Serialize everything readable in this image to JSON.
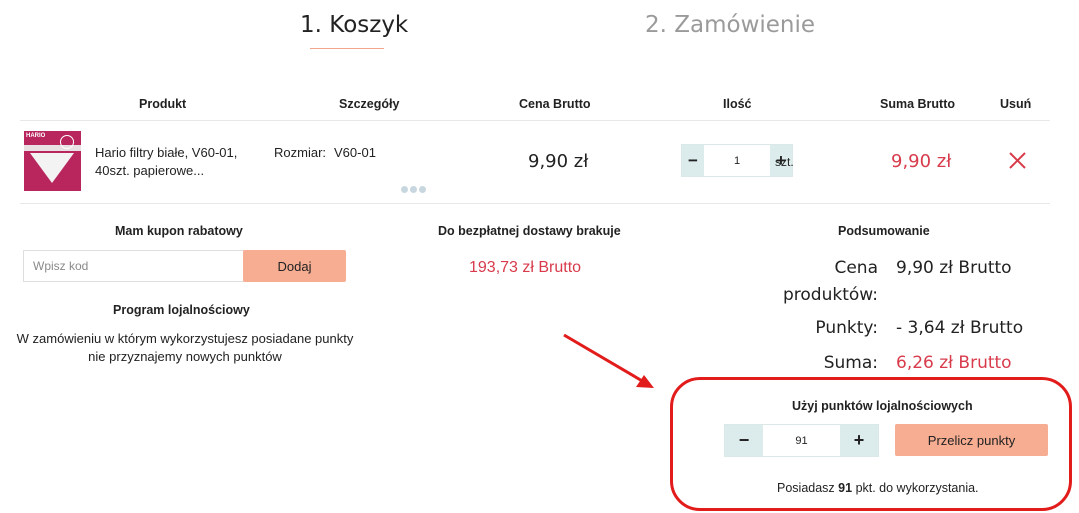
{
  "steps": [
    {
      "label": "1. Koszyk"
    },
    {
      "label": "2. Zamówienie"
    }
  ],
  "table": {
    "headers": [
      "Produkt",
      "Szczegóły",
      "Cena Brutto",
      "Ilość",
      "Suma Brutto",
      "Usuń"
    ],
    "row": {
      "product_name": "Hario filtry białe, V60-01, 40szt. papierowe...",
      "thumbnail_brand": "HARIO",
      "detail_label": "Rozmiar:",
      "detail_value": "V60-01",
      "price": "9,90 zł",
      "quantity": "1",
      "quantity_unit": "szt.",
      "total": "9,90 zł",
      "minus": "−",
      "plus": "+"
    }
  },
  "coupon": {
    "title": "Mam kupon rabatowy",
    "placeholder": "Wpisz kod",
    "button": "Dodaj"
  },
  "loyalty_program": {
    "title": "Program lojalnościowy",
    "text": "W zamówieniu w którym wykorzystujesz posiadane punkty nie przyznajemy nowych punktów"
  },
  "shipping": {
    "title": "Do bezpłatnej dostawy brakuje",
    "amount": "193,73 zł Brutto"
  },
  "summary": {
    "title": "Podsumowanie",
    "product_cost_label_1": "Cena",
    "product_cost_label_2": "produktów:",
    "product_cost_value": "9,90 zł Brutto",
    "points_label": "Punkty:",
    "points_value": "- 3,64 zł Brutto",
    "total_label": "Suma:",
    "total_value": "6,26 zł Brutto"
  },
  "use_points": {
    "title": "Użyj punktów lojalnościowych",
    "value": "91",
    "minus": "−",
    "plus": "+",
    "button": "Przelicz punkty",
    "have_prefix": "Posiadasz",
    "have_points": "91",
    "have_suffix": "pkt. do wykorzystania."
  },
  "colors": {
    "accent": "#f7ad92",
    "price_red": "#d83b4c",
    "highlight": "#e21b1b",
    "stepper_bg": "#dcecec"
  }
}
